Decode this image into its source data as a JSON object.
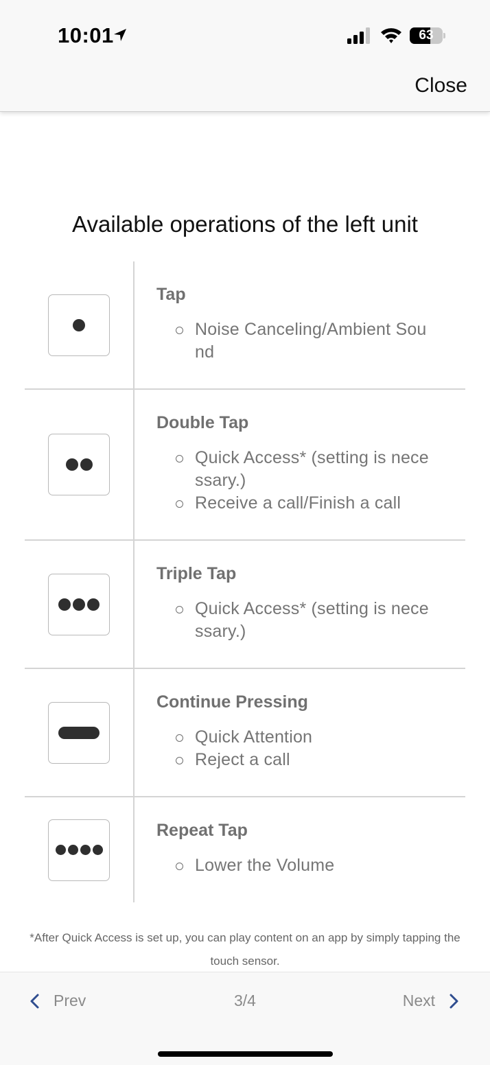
{
  "status_bar": {
    "time": "10:01",
    "battery_level": "63",
    "icons": [
      "location-arrow-icon",
      "cellular-signal-icon",
      "wifi-icon",
      "battery-icon"
    ]
  },
  "header": {
    "close_label": "Close"
  },
  "page": {
    "title": "Available operations of the left unit"
  },
  "operations": [
    {
      "icon": "single-dot-icon",
      "title": "Tap",
      "items": [
        "Noise Canceling/Ambient Sou nd"
      ]
    },
    {
      "icon": "double-dot-icon",
      "title": "Double Tap",
      "items": [
        "Quick Access* (setting is nece ssary.)",
        "Receive a call/Finish a call"
      ]
    },
    {
      "icon": "triple-dot-icon",
      "title": "Triple Tap",
      "items": [
        "Quick Access* (setting is nece ssary.)"
      ]
    },
    {
      "icon": "long-press-bar-icon",
      "title": "Continue Pressing",
      "items": [
        "Quick Attention",
        "Reject a call"
      ]
    },
    {
      "icon": "four-dot-icon",
      "title": "Repeat Tap",
      "items": [
        "Lower the Volume"
      ]
    }
  ],
  "footnote": "*After Quick Access is set up, you can play content on an app by simply tapping the touch sensor.",
  "navigation": {
    "prev_label": "Prev",
    "next_label": "Next",
    "page_indicator": "3/4"
  },
  "colors": {
    "chevron": "#2f4d8f",
    "icon_fill": "#2f2f2f",
    "muted_text": "#757575"
  }
}
